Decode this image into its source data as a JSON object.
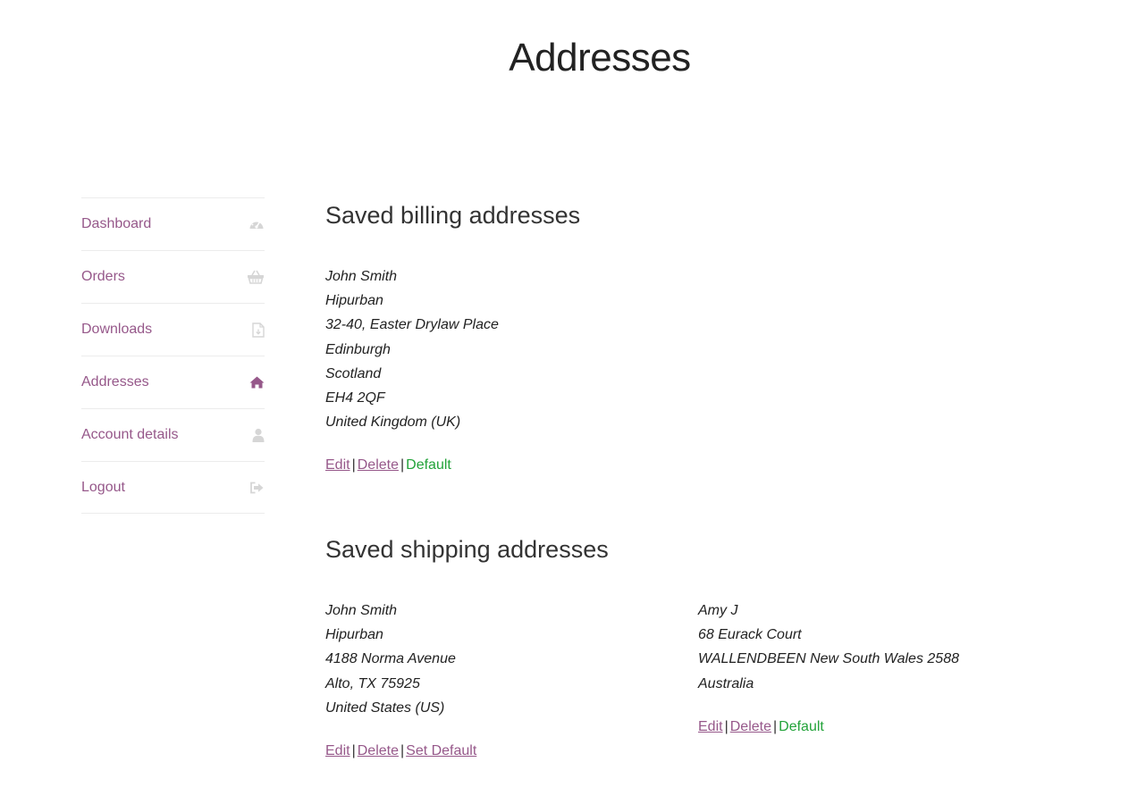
{
  "page": {
    "title": "Addresses"
  },
  "nav": {
    "items": [
      {
        "label": "Dashboard",
        "icon": "dashboard-gauge-icon"
      },
      {
        "label": "Orders",
        "icon": "shopping-basket-icon"
      },
      {
        "label": "Downloads",
        "icon": "file-download-icon"
      },
      {
        "label": "Addresses",
        "icon": "home-icon",
        "active": true
      },
      {
        "label": "Account details",
        "icon": "user-icon"
      },
      {
        "label": "Logout",
        "icon": "sign-out-icon"
      }
    ]
  },
  "billing": {
    "title": "Saved billing addresses",
    "addresses": [
      {
        "lines": [
          "John Smith",
          "Hipurban",
          "32-40, Easter Drylaw Place",
          "Edinburgh",
          "Scotland",
          "EH4 2QF",
          "United Kingdom (UK)"
        ],
        "edit_label": "Edit",
        "delete_label": "Delete",
        "default_label": "Default"
      }
    ]
  },
  "shipping": {
    "title": "Saved shipping addresses",
    "addresses": [
      {
        "lines": [
          "John Smith",
          "Hipurban",
          "4188 Norma Avenue",
          "Alto, TX 75925",
          "United States (US)"
        ],
        "edit_label": "Edit",
        "delete_label": "Delete",
        "set_default_label": "Set Default"
      },
      {
        "lines": [
          "Amy J",
          "68 Eurack Court",
          "WALLENDBEEN New South Wales 2588",
          "Australia"
        ],
        "edit_label": "Edit",
        "delete_label": "Delete",
        "default_label": "Default"
      }
    ]
  },
  "separator": "|",
  "colors": {
    "link": "#96588a",
    "default": "#23a33a",
    "nav_icon": "#d6d6d6",
    "nav_icon_active": "#96588a"
  }
}
